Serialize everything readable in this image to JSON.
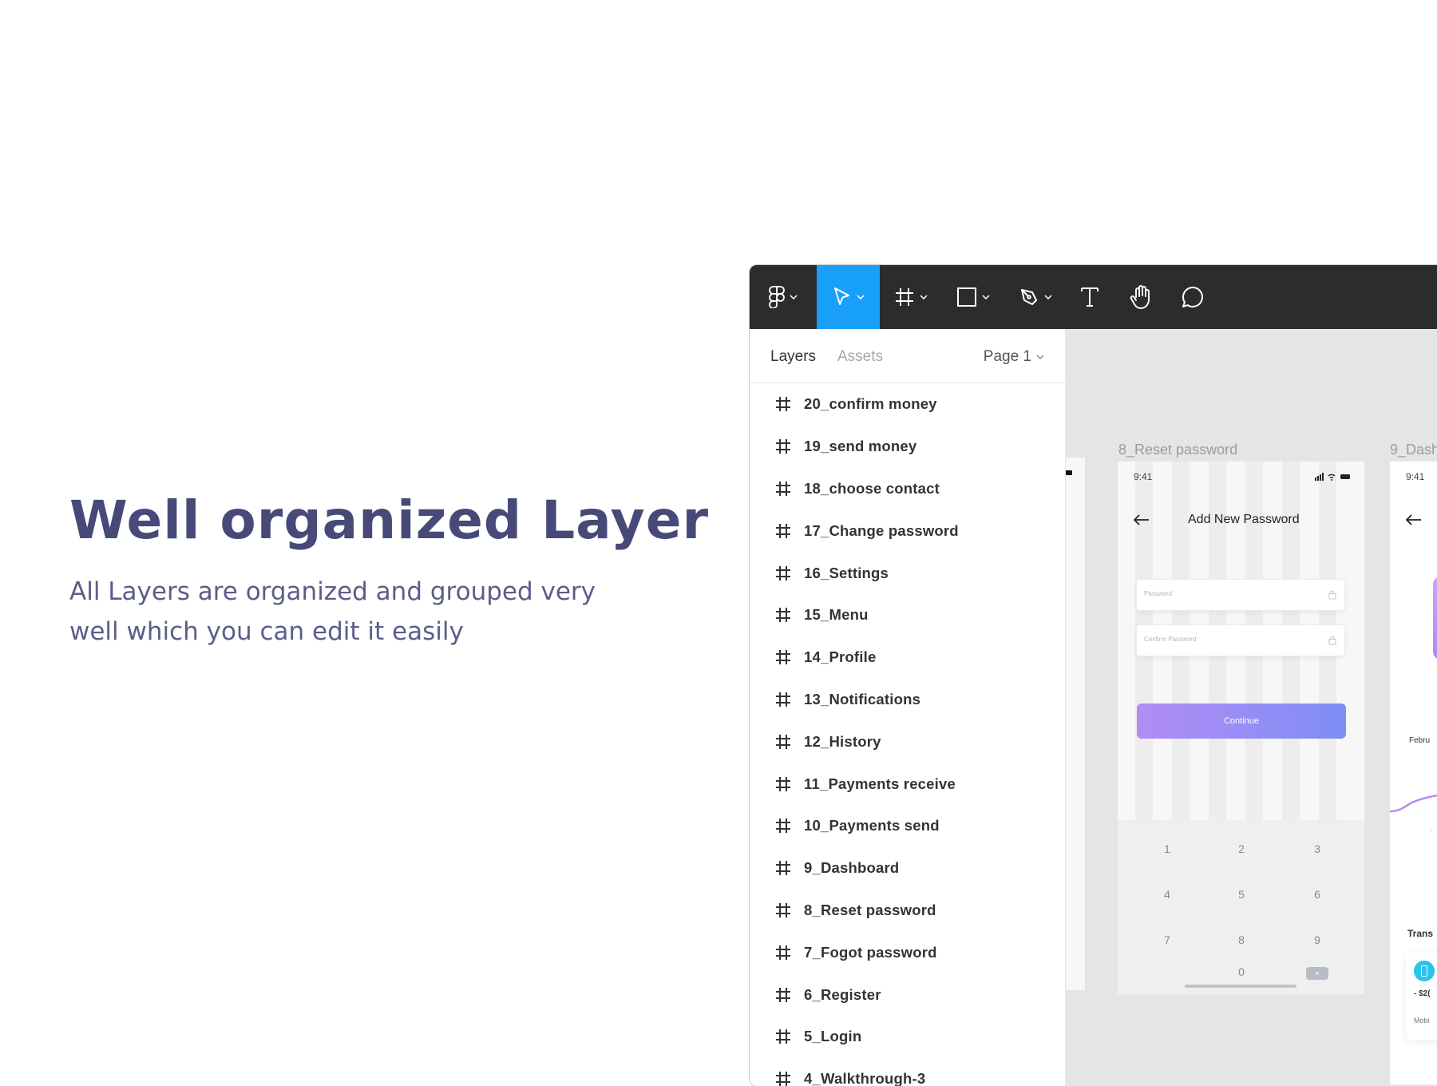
{
  "hero": {
    "title": "Well organized  Layer",
    "subtitle": "All Layers are organized and  grouped very well which you  can edit it easily"
  },
  "toolbar": {
    "tools": [
      "figma-menu",
      "move",
      "frame",
      "rectangle",
      "pen",
      "text",
      "hand",
      "comment"
    ],
    "active_tool": "move",
    "active_color": "#18a0fb"
  },
  "panel": {
    "tabs": {
      "layers": "Layers",
      "assets": "Assets"
    },
    "page_selector": "Page 1",
    "layers": [
      "20_confirm money",
      "19_send money",
      "18_choose contact",
      "17_Change password",
      "16_Settings",
      "15_Menu",
      "14_Profile",
      "13_Notifications",
      "12_History",
      "11_Payments receive",
      "10_Payments send",
      "9_Dashboard",
      "8_Reset password",
      "7_Fogot password",
      "6_Register",
      "5_Login",
      "4_Walkthrough-3"
    ]
  },
  "canvas": {
    "frame_8": {
      "label": "8_Reset password",
      "time": "9:41",
      "title": "Add New Password",
      "password_placeholder": "Password",
      "confirm_placeholder": "Confirm Password",
      "button": "Continue",
      "keys": [
        "1",
        "2",
        "3",
        "4",
        "5",
        "6",
        "7",
        "8",
        "9",
        "0"
      ],
      "delete_key": "×"
    },
    "frame_9": {
      "label": "9_Dash",
      "time": "9:41",
      "fragment_month": "Febru",
      "fragment_transactions": "Trans",
      "fragment_amount": "- $2(",
      "fragment_mobile": "Mobi"
    }
  }
}
